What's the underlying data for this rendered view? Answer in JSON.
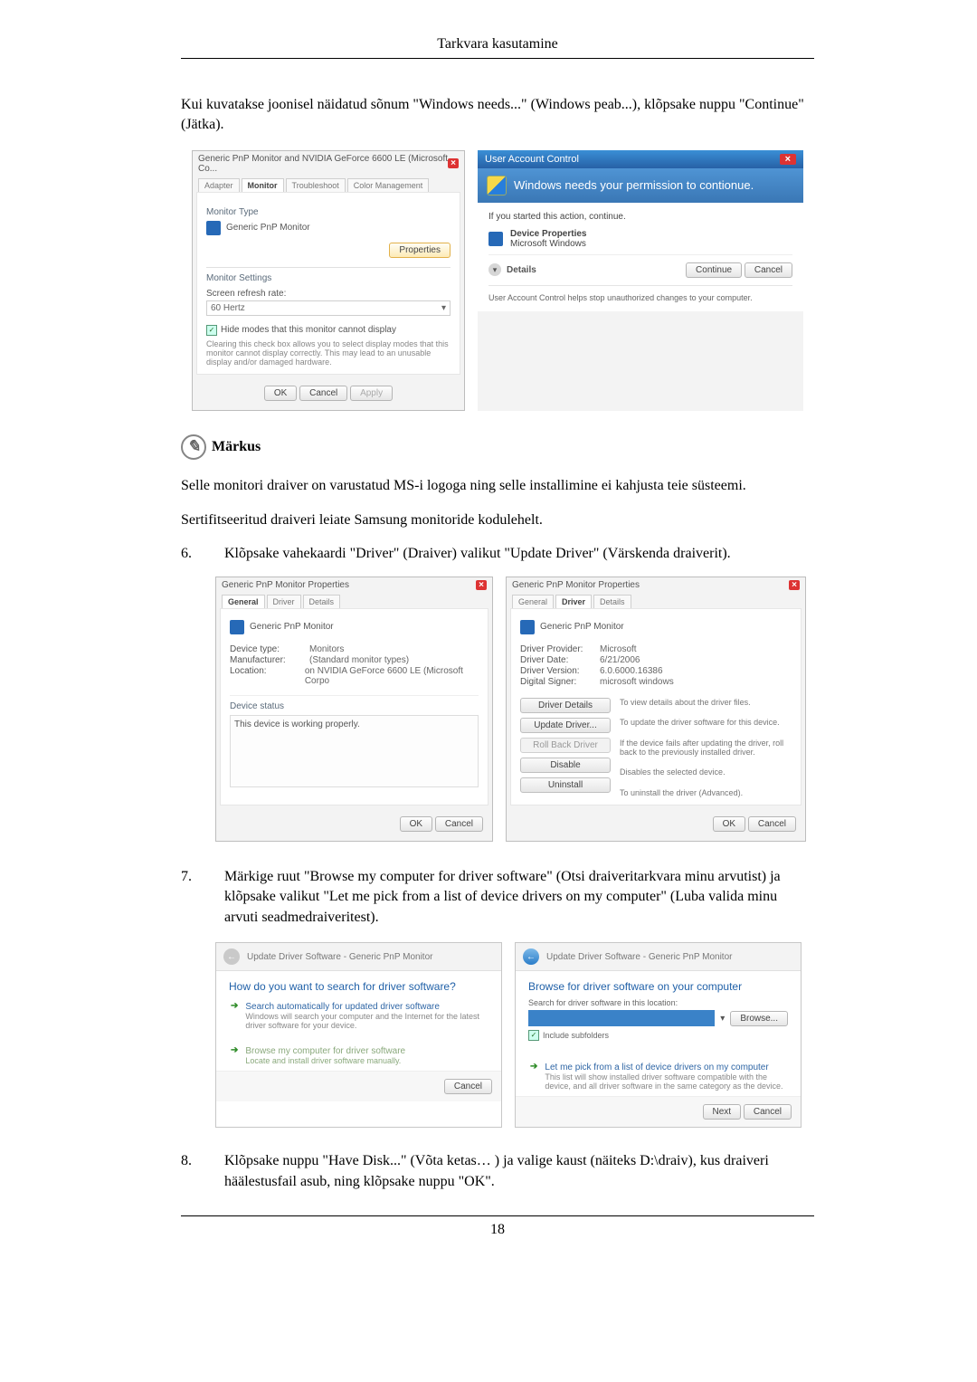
{
  "header": "Tarkvara kasutamine",
  "page_number": "18",
  "intro_text": "Kui kuvatakse joonisel näidatud sõnum \"Windows needs...\" (Windows peab...), klõpsake nuppu \"Continue\" (Jätka).",
  "monitor_dialog": {
    "title": "Generic PnP Monitor and NVIDIA GeForce 6600 LE (Microsoft Co...",
    "tabs": {
      "adapter": "Adapter",
      "monitor": "Monitor",
      "troubleshoot": "Troubleshoot",
      "color": "Color Management"
    },
    "monitor_type_label": "Monitor Type",
    "monitor_type_value": "Generic PnP Monitor",
    "properties_btn": "Properties",
    "settings_label": "Monitor Settings",
    "refresh_rate_label": "Screen refresh rate:",
    "refresh_rate_value": "60 Hertz",
    "checkbox_label": "Hide modes that this monitor cannot display",
    "checkbox_help": "Clearing this check box allows you to select display modes that this monitor cannot display correctly. This may lead to an unusable display and/or damaged hardware.",
    "ok": "OK",
    "cancel": "Cancel",
    "apply": "Apply"
  },
  "uac_dialog": {
    "titlebar": "User Account Control",
    "heading": "Windows needs your permission to contionue.",
    "line1": "If you started this action, continue.",
    "prop1": "Device Properties",
    "prop2": "Microsoft Windows",
    "details": "Details",
    "continue": "Continue",
    "cancel": "Cancel",
    "footer_note": "User Account Control helps stop unauthorized changes to your computer."
  },
  "note": {
    "label": "Märkus",
    "line1": "Selle monitori draiver on varustatud MS-i logoga ning selle installimine ei kahjusta teie süsteemi.",
    "line2": "Sertifitseeritud draiveri leiate Samsung monitoride kodulehelt."
  },
  "step6": {
    "num": "6.",
    "text": "Klõpsake vahekaardi \"Driver\" (Draiver) valikut \"Update Driver\" (Värskenda draiverit)."
  },
  "props_general": {
    "title": "Generic PnP Monitor Properties",
    "tab_general": "General",
    "tab_driver": "Driver",
    "tab_details": "Details",
    "heading": "Generic PnP Monitor",
    "kv": {
      "device_type_k": "Device type:",
      "device_type_v": "Monitors",
      "manufacturer_k": "Manufacturer:",
      "manufacturer_v": "(Standard monitor types)",
      "location_k": "Location:",
      "location_v": "on NVIDIA GeForce 6600 LE (Microsoft Corpo"
    },
    "status_label": "Device status",
    "status_text": "This device is working properly.",
    "ok": "OK",
    "cancel": "Cancel"
  },
  "props_driver": {
    "title": "Generic PnP Monitor Properties",
    "heading": "Generic PnP Monitor",
    "kv": {
      "provider_k": "Driver Provider:",
      "provider_v": "Microsoft",
      "date_k": "Driver Date:",
      "date_v": "6/21/2006",
      "version_k": "Driver Version:",
      "version_v": "6.0.6000.16386",
      "signer_k": "Digital Signer:",
      "signer_v": "microsoft windows"
    },
    "buttons": {
      "details": "Driver Details",
      "details_sub": "To view details about the driver files.",
      "update": "Update Driver...",
      "update_sub": "To update the driver software for this device.",
      "rollback": "Roll Back Driver",
      "rollback_sub": "If the device fails after updating the driver, roll back to the previously installed driver.",
      "disable": "Disable",
      "disable_sub": "Disables the selected device.",
      "uninstall": "Uninstall",
      "uninstall_sub": "To uninstall the driver (Advanced)."
    },
    "ok": "OK",
    "cancel": "Cancel"
  },
  "step7": {
    "num": "7.",
    "text": "Märkige ruut \"Browse my computer for driver software\" (Otsi draiveritarkvara minu arvutist) ja klõpsake valikut \"Let me pick from a list of device drivers on my computer\" (Luba valida minu arvuti seadmedraiveritest)."
  },
  "wizard1": {
    "crumb": "Update Driver Software - Generic PnP Monitor",
    "question": "How do you want to search for driver software?",
    "opt1": "Search automatically for updated driver software",
    "opt1_sub": "Windows will search your computer and the Internet for the latest driver software for your device.",
    "opt2": "Browse my computer for driver software",
    "opt2_sub": "Locate and install driver software manually.",
    "cancel": "Cancel"
  },
  "wizard2": {
    "crumb": "Update Driver Software - Generic PnP Monitor",
    "heading": "Browse for driver software on your computer",
    "loc_label": "Search for driver software in this location:",
    "browse": "Browse...",
    "include_sub": "Include subfolders",
    "opt": "Let me pick from a list of device drivers on my computer",
    "opt_sub": "This list will show installed driver software compatible with the device, and all driver software in the same category as the device.",
    "next": "Next",
    "cancel": "Cancel"
  },
  "step8": {
    "num": "8.",
    "text": "Klõpsake nuppu \"Have Disk...\" (Võta ketas… ) ja valige kaust (näiteks D:\\draiv), kus draiveri häälestusfail asub, ning klõpsake nuppu \"OK\"."
  }
}
